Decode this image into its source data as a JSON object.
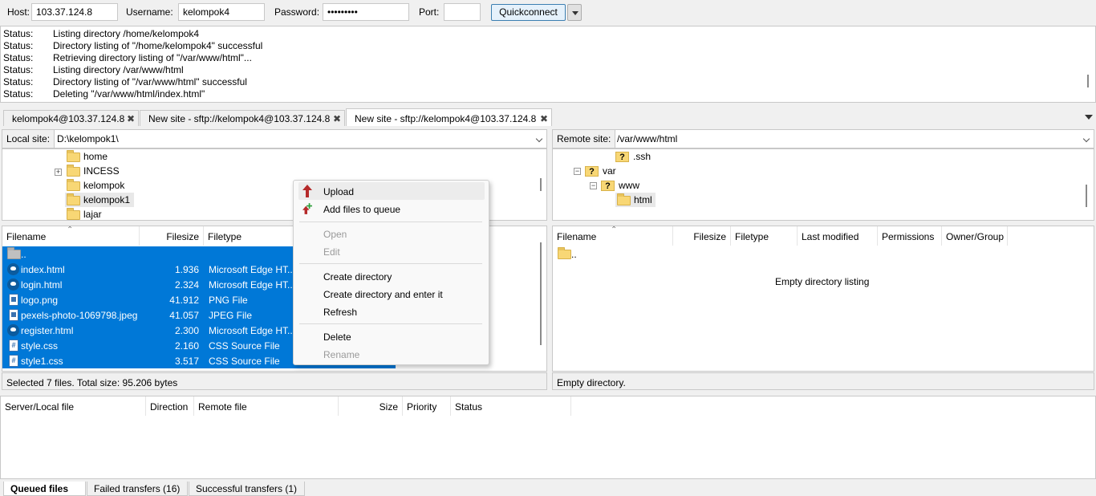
{
  "quickconnect": {
    "host_label": "Host:",
    "host_value": "103.37.124.8",
    "username_label": "Username:",
    "username_value": "kelompok4",
    "password_label": "Password:",
    "password_value": "•••••••••",
    "port_label": "Port:",
    "port_value": "",
    "button_label": "Quickconnect"
  },
  "log": [
    {
      "status": "Status:",
      "message": "Listing directory /home/kelompok4"
    },
    {
      "status": "Status:",
      "message": "Directory listing of \"/home/kelompok4\" successful"
    },
    {
      "status": "Status:",
      "message": "Retrieving directory listing of \"/var/www/html\"..."
    },
    {
      "status": "Status:",
      "message": "Listing directory /var/www/html"
    },
    {
      "status": "Status:",
      "message": "Directory listing of \"/var/www/html\" successful"
    },
    {
      "status": "Status:",
      "message": "Deleting \"/var/www/html/index.html\""
    }
  ],
  "tabs": [
    {
      "label": "kelompok4@103.37.124.8",
      "close": "✖"
    },
    {
      "label": "New site - sftp://kelompok4@103.37.124.8",
      "close": "✖"
    },
    {
      "label": "New site - sftp://kelompok4@103.37.124.8",
      "close": "✖"
    }
  ],
  "local": {
    "site_label": "Local site:",
    "path": "D:\\kelompok1\\",
    "tree": [
      {
        "name": "home"
      },
      {
        "name": "INCESS",
        "expander": "+"
      },
      {
        "name": "kelompok"
      },
      {
        "name": "kelompok1"
      },
      {
        "name": "lajar"
      }
    ],
    "columns": {
      "filename": "Filename",
      "filesize": "Filesize",
      "filetype": "Filetype"
    },
    "files": [
      {
        "name": "..",
        "size": "",
        "type": "",
        "icon": "folder-icon"
      },
      {
        "name": "index.html",
        "size": "1.936",
        "type": "Microsoft Edge HT...",
        "icon": "edge-html-icon"
      },
      {
        "name": "login.html",
        "size": "2.324",
        "type": "Microsoft Edge HT...",
        "icon": "edge-html-icon"
      },
      {
        "name": "logo.png",
        "size": "41.912",
        "type": "PNG File",
        "icon": "image-file-icon"
      },
      {
        "name": "pexels-photo-1069798.jpeg",
        "size": "41.057",
        "type": "JPEG File",
        "icon": "image-file-icon"
      },
      {
        "name": "register.html",
        "size": "2.300",
        "type": "Microsoft Edge HT...",
        "icon": "edge-html-icon"
      },
      {
        "name": "style.css",
        "size": "2.160",
        "type": "CSS Source File",
        "icon": "css-file-icon"
      },
      {
        "name": "style1.css",
        "size": "3.517",
        "type": "CSS Source File",
        "icon": "css-file-icon"
      }
    ],
    "status": "Selected 7 files. Total size: 95.206 bytes"
  },
  "remote": {
    "site_label": "Remote site:",
    "path": "/var/www/html",
    "tree": [
      {
        "name": ".ssh",
        "mark": "?"
      },
      {
        "name": "var",
        "mark": "?",
        "expander": "−"
      },
      {
        "name": "www",
        "mark": "?",
        "expander": "−"
      },
      {
        "name": "html"
      }
    ],
    "columns": {
      "filename": "Filename",
      "filesize": "Filesize",
      "filetype": "Filetype",
      "modified": "Last modified",
      "permissions": "Permissions",
      "owner": "Owner/Group"
    },
    "parent": "..",
    "empty_text": "Empty directory listing",
    "status": "Empty directory."
  },
  "context_menu": {
    "upload": "Upload",
    "add_to_queue": "Add files to queue",
    "open": "Open",
    "edit": "Edit",
    "create_dir": "Create directory",
    "create_dir_enter": "Create directory and enter it",
    "refresh": "Refresh",
    "delete": "Delete",
    "rename": "Rename"
  },
  "queue": {
    "columns": {
      "file": "Server/Local file",
      "direction": "Direction",
      "remote": "Remote file",
      "size": "Size",
      "priority": "Priority",
      "status": "Status"
    },
    "tabs": {
      "queued": "Queued files",
      "failed": "Failed transfers (16)",
      "successful": "Successful transfers (1)"
    }
  },
  "colors": {
    "selection": "#0078d7",
    "accent": "#3c7fb1"
  }
}
